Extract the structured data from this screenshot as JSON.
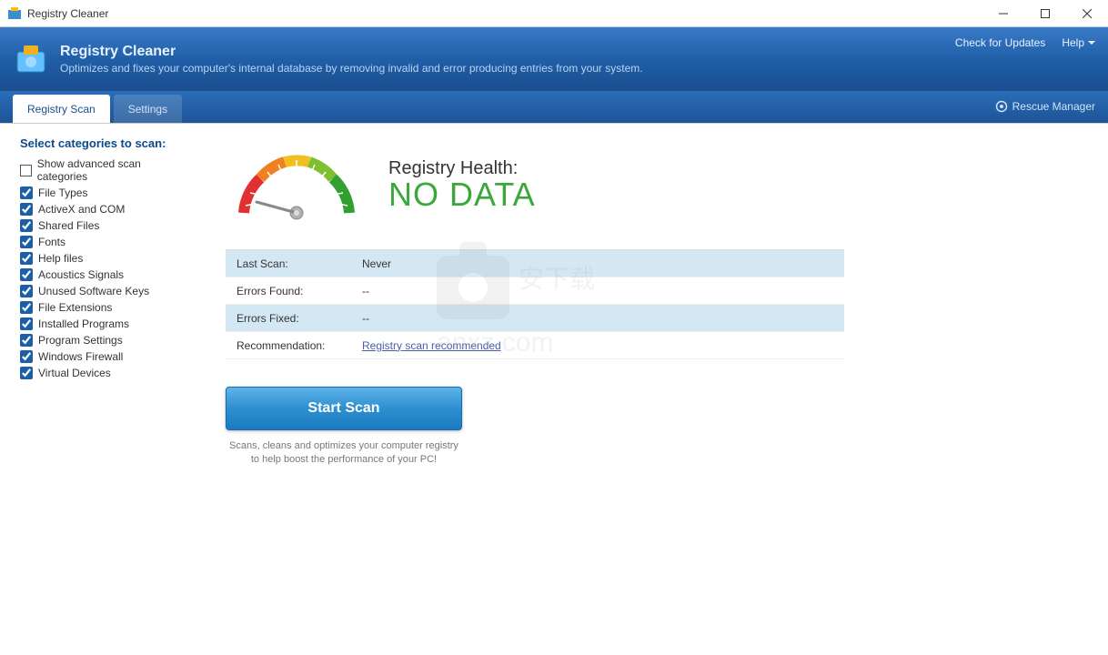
{
  "window": {
    "title": "Registry Cleaner"
  },
  "header": {
    "title": "Registry Cleaner",
    "subtitle": "Optimizes and fixes your computer's internal database by removing invalid and error producing entries from your system.",
    "check_updates": "Check for Updates",
    "help": "Help"
  },
  "tabs": {
    "scan": "Registry Scan",
    "settings": "Settings"
  },
  "rescue": "Rescue Manager",
  "sidebar": {
    "title": "Select categories to scan:",
    "advanced": "Show advanced scan categories",
    "items": [
      "File Types",
      "ActiveX and COM",
      "Shared Files",
      "Fonts",
      "Help files",
      "Acoustics Signals",
      "Unused Software Keys",
      "File Extensions",
      "Installed Programs",
      "Program Settings",
      "Windows Firewall",
      "Virtual Devices"
    ]
  },
  "health": {
    "label": "Registry Health:",
    "value": "NO DATA"
  },
  "info": {
    "last_scan_k": "Last Scan:",
    "last_scan_v": "Never",
    "errors_found_k": "Errors Found:",
    "errors_found_v": "--",
    "errors_fixed_k": "Errors Fixed:",
    "errors_fixed_v": "--",
    "recommend_k": "Recommendation:",
    "recommend_v": "Registry scan recommended"
  },
  "start": "Start Scan",
  "note": "Scans, cleans and optimizes your computer registry to help boost the performance of your PC!",
  "watermark": "anxz.com"
}
